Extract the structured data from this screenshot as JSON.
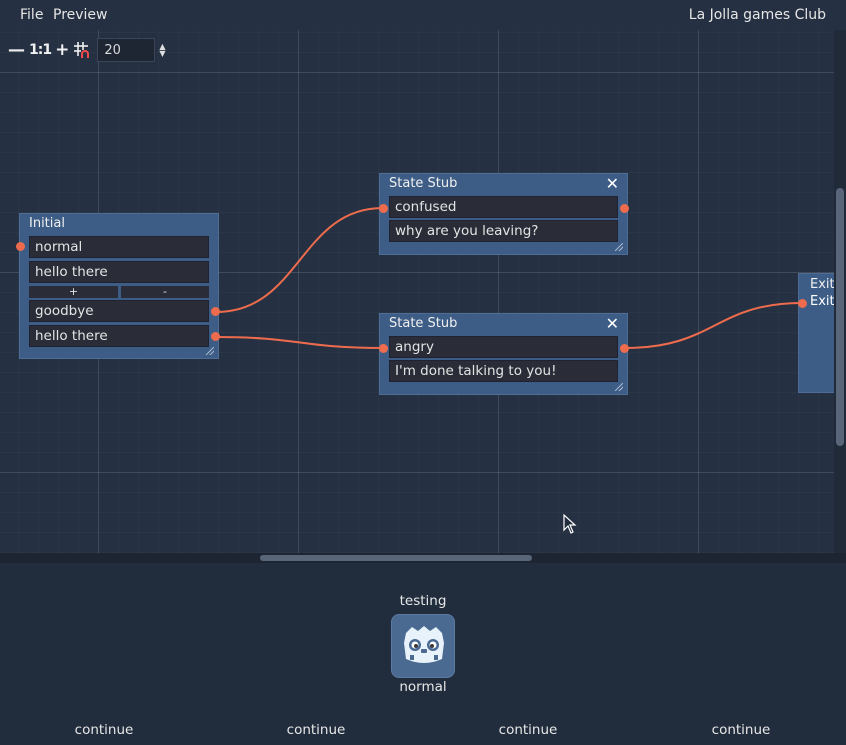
{
  "menu": {
    "file": "File",
    "preview": "Preview",
    "app_title": "La Jolla games Club"
  },
  "toolbar": {
    "zoom_out": "—",
    "zoom_reset": "1:1",
    "zoom_in": "+",
    "snap_icon": "grid-snap-icon",
    "snap_value": "20"
  },
  "nodes": {
    "initial": {
      "title": "Initial",
      "fields": [
        "normal",
        "hello there"
      ],
      "add_label": "+",
      "remove_label": "-",
      "choices": [
        "goodbye",
        "hello there"
      ]
    },
    "stub1": {
      "title": "State Stub",
      "close": "✕",
      "state": "confused",
      "line": "why are you leaving?"
    },
    "stub2": {
      "title": "State Stub",
      "close": "✕",
      "state": "angry",
      "line": "I'm done talking to you!"
    },
    "exit": {
      "title": "Exit",
      "label": "Exit"
    }
  },
  "preview": {
    "character_name": "testing",
    "state": "normal",
    "avatar_icon": "godot-robot-icon",
    "buttons": [
      "continue",
      "continue",
      "continue",
      "continue"
    ]
  },
  "colors": {
    "node": "#3d5d86",
    "port": "#ee6c4d",
    "wire": "#ee6c4d",
    "background": "#253142"
  }
}
